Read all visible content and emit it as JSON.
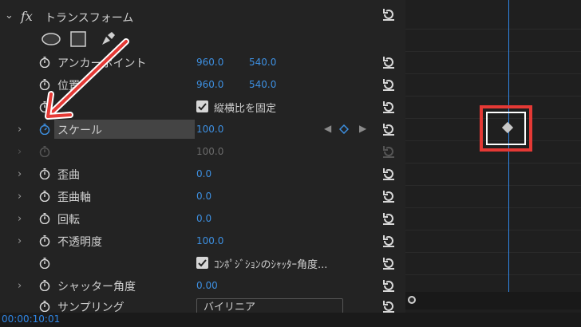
{
  "section": {
    "title": "トランスフォーム"
  },
  "properties": [
    {
      "id": "anchor",
      "label": "アンカーポイント",
      "v1": "960.0",
      "v2": "540.0"
    },
    {
      "id": "position",
      "label": "位置",
      "v1": "960.0",
      "v2": "540.0"
    },
    {
      "id": "uniform",
      "checkbox_label": "縦横比を固定",
      "checked": true
    },
    {
      "id": "scale",
      "label": "スケール",
      "v1": "100.0"
    },
    {
      "id": "scale_width",
      "label": "",
      "v1": "100.0"
    },
    {
      "id": "skew",
      "label": "歪曲",
      "v1": "0.0"
    },
    {
      "id": "skew_axis",
      "label": "歪曲軸",
      "v1": "0.0"
    },
    {
      "id": "rotation",
      "label": "回転",
      "v1": "0.0"
    },
    {
      "id": "opacity",
      "label": "不透明度",
      "v1": "100.0"
    },
    {
      "id": "comp_shutter",
      "checkbox_label": "ｺﾝﾎﾟｼﾞｼｮﾝのｼｬｯﾀｰ角度...",
      "checked": true
    },
    {
      "id": "shutter",
      "label": "シャッター角度",
      "v1": "0.00"
    },
    {
      "id": "sampling",
      "label": "サンプリング",
      "dropdown": "バイリニア"
    }
  ],
  "status": {
    "timecode": "00:00:10:01"
  },
  "colors": {
    "accent": "#3d8fe0",
    "playhead": "#2f86e6",
    "highlight": "#e53935"
  }
}
